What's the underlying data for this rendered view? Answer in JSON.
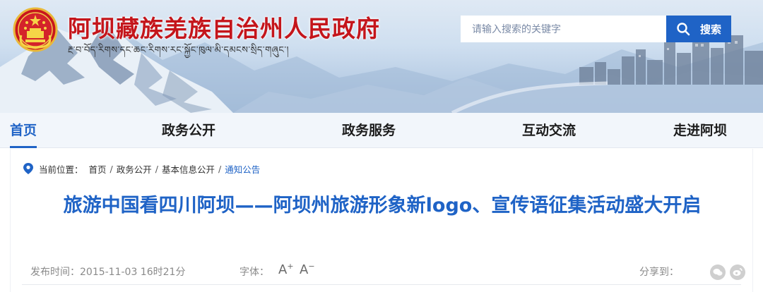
{
  "header": {
    "title": "阿坝藏族羌族自治州人民政府",
    "subtitle": "རྔ་བ་བོད་རིགས་དང་ཆང་རིགས་རང་སྐྱོང་ཁུལ་མི་དམངས་སྲིད་གཞུང་།",
    "search_placeholder": "请输入搜索的关键字",
    "search_button": "搜索"
  },
  "nav": {
    "items": [
      "首页",
      "政务公开",
      "政务服务",
      "互动交流",
      "走进阿坝"
    ],
    "active_index": 0
  },
  "breadcrumb": {
    "label": "当前位置：",
    "items": [
      "首页",
      "政务公开",
      "基本信息公开",
      "通知公告"
    ],
    "separator": "/"
  },
  "article": {
    "title": "旅游中国看四川阿坝——阿坝州旅游形象新logo、宣传语征集活动盛大开启",
    "published_label": "发布时间：",
    "published": "2015-11-03 16时21分",
    "font_label": "字体：",
    "font_increase": "A",
    "font_decrease": "A",
    "share_label": "分享到："
  },
  "colors": {
    "primary": "#1f63c6",
    "title_red": "#c4151b",
    "nav_bg": "#f2f6fb"
  },
  "icons": [
    "national-emblem-icon",
    "search-icon",
    "location-pin-icon",
    "wechat-icon",
    "weibo-icon"
  ]
}
